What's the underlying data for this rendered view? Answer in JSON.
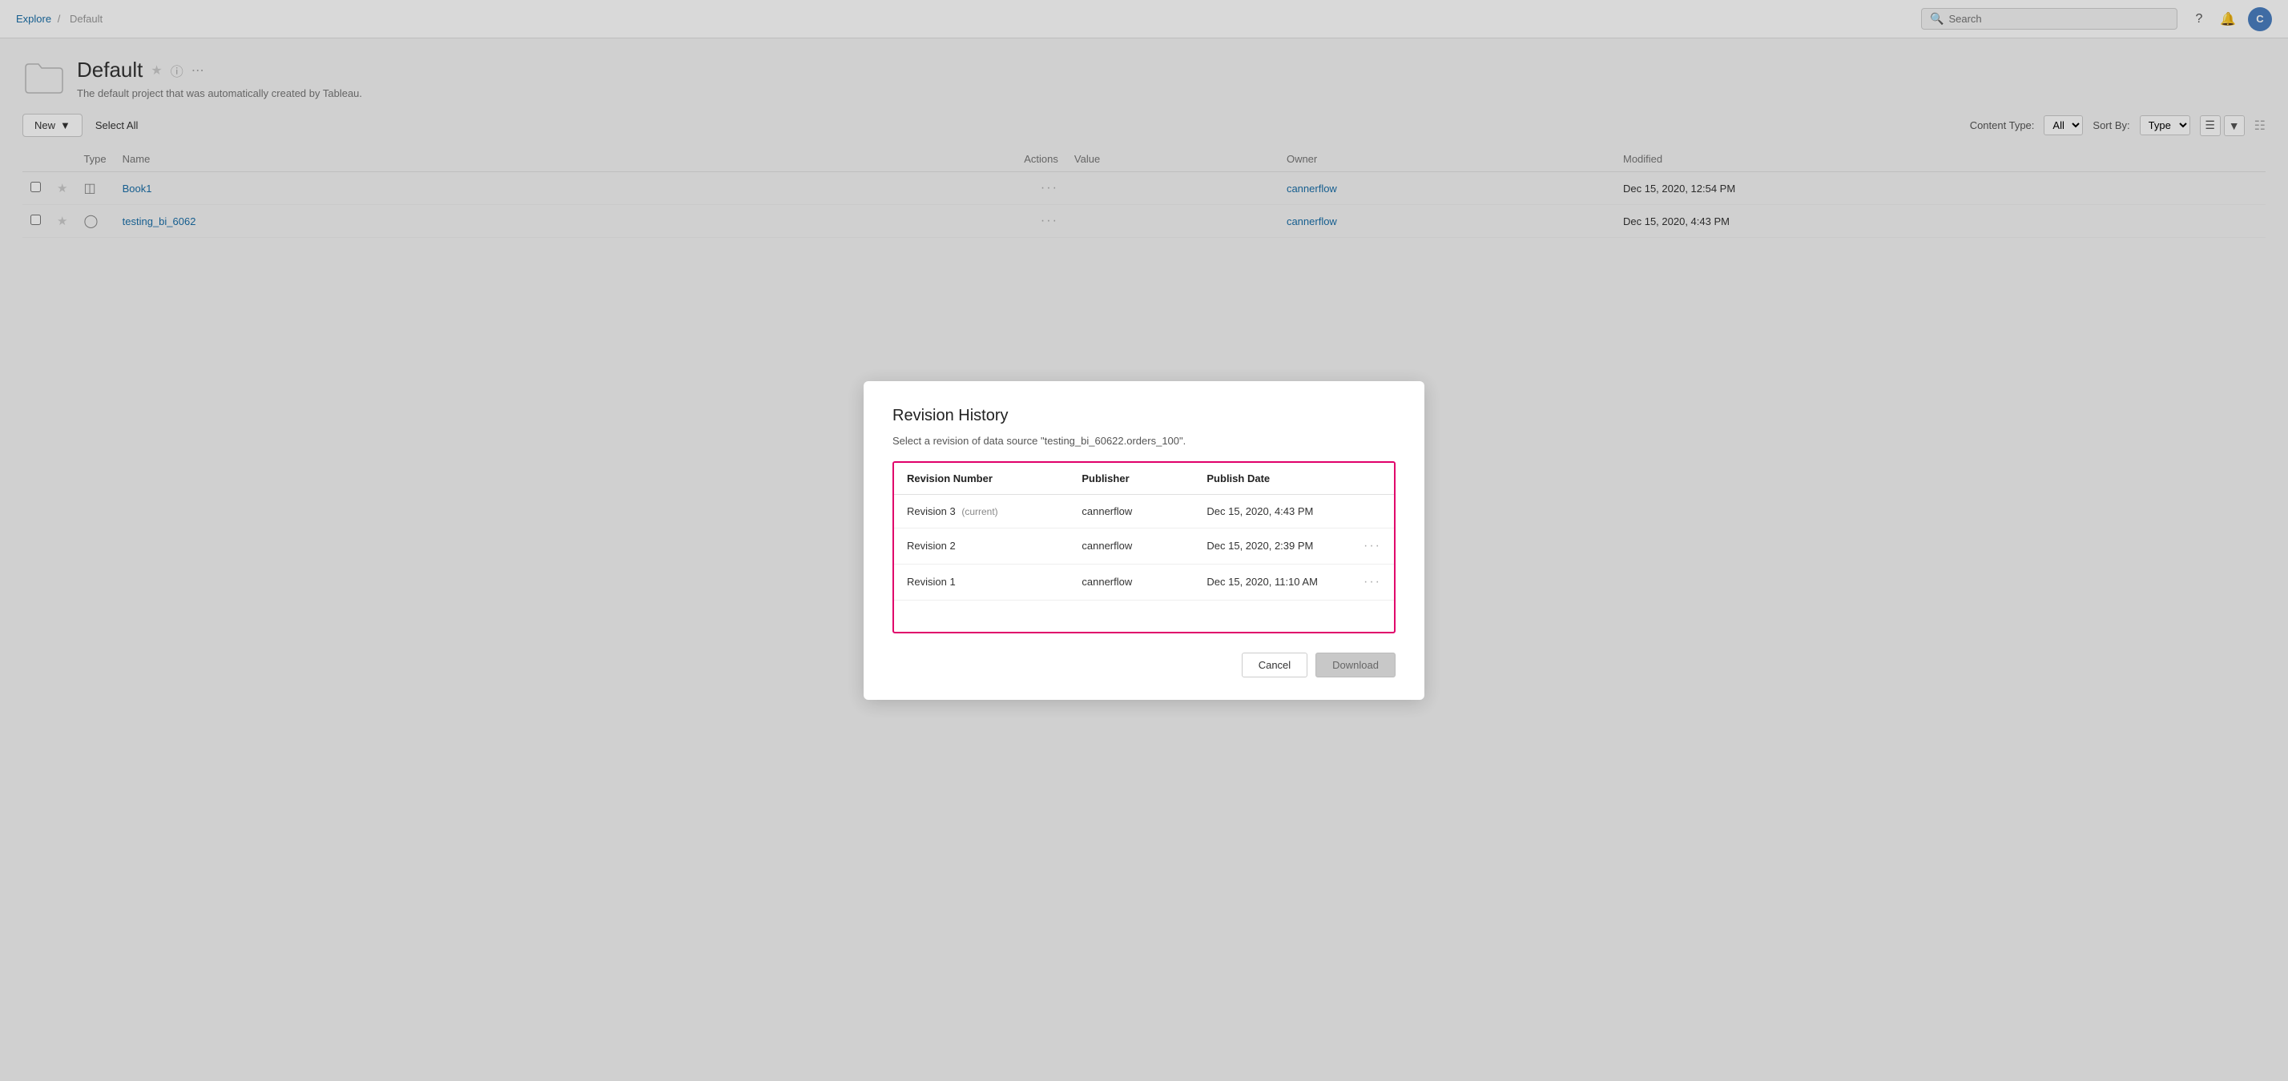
{
  "topbar": {
    "breadcrumb_explore": "Explore",
    "breadcrumb_separator": "/",
    "breadcrumb_current": "Default",
    "search_placeholder": "Search",
    "avatar_initials": "C"
  },
  "project": {
    "title": "Default",
    "description": "The default project that was automatically created by Tableau."
  },
  "toolbar": {
    "new_label": "New",
    "select_all_label": "Select All",
    "content_type_label": "Content Type:",
    "content_type_value": "All",
    "sort_by_label": "Sort By:",
    "sort_by_value": "Type"
  },
  "table": {
    "headers": [
      "",
      "",
      "Type",
      "Name",
      "",
      "",
      "",
      "Actions",
      "Value",
      "Owner",
      "Modified"
    ],
    "rows": [
      {
        "type": "workbook",
        "name": "Book1",
        "owner": "cannerflow",
        "modified": "Dec 15, 2020, 12:54 PM"
      },
      {
        "type": "datasource",
        "name": "testing_bi_6062",
        "owner": "cannerflow",
        "modified": "Dec 15, 2020, 4:43 PM"
      }
    ]
  },
  "dialog": {
    "title": "Revision History",
    "subtitle": "Select a revision of data source \"testing_bi_60622.orders_100\".",
    "table_headers": {
      "revision_number": "Revision Number",
      "publisher": "Publisher",
      "publish_date": "Publish Date"
    },
    "revisions": [
      {
        "number": "Revision 3",
        "current": true,
        "current_label": "(current)",
        "publisher": "cannerflow",
        "publish_date": "Dec 15, 2020, 4:43 PM",
        "has_actions": false
      },
      {
        "number": "Revision 2",
        "current": false,
        "current_label": "",
        "publisher": "cannerflow",
        "publish_date": "Dec 15, 2020, 2:39 PM",
        "has_actions": true
      },
      {
        "number": "Revision 1",
        "current": false,
        "current_label": "",
        "publisher": "cannerflow",
        "publish_date": "Dec 15, 2020, 11:10 AM",
        "has_actions": true
      }
    ],
    "cancel_label": "Cancel",
    "download_label": "Download"
  }
}
